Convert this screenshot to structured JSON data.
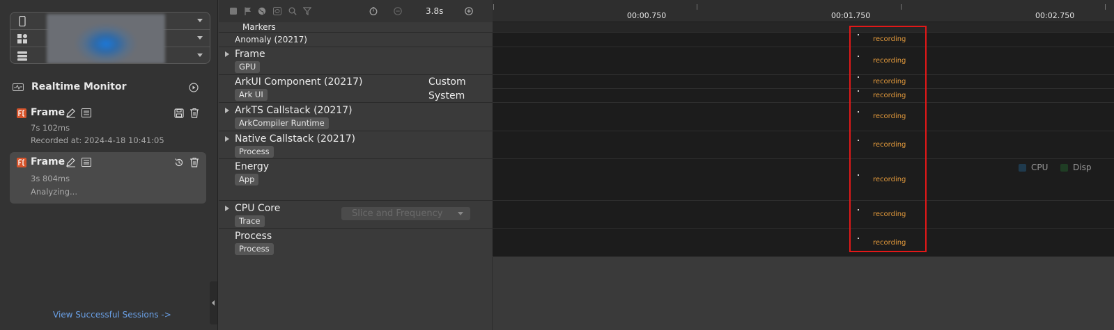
{
  "sidebar": {
    "realtime_monitor": "Realtime Monitor",
    "sessions": [
      {
        "title": "Frame",
        "duration": "7s 102ms",
        "status": "Recorded at: 2024-4-18 10:41:05"
      },
      {
        "title": "Frame",
        "duration": "3s 804ms",
        "status": "Analyzing..."
      }
    ],
    "view_link": "View Successful Sessions ->"
  },
  "toolbar": {
    "zoom_value": "3.8s",
    "icons": [
      "stop-icon",
      "flag-icon",
      "globe-icon",
      "refresh-icon",
      "search-icon",
      "filter-icon",
      "timer-icon",
      "zoom-out-icon",
      "zoom-in-icon"
    ]
  },
  "ruler": {
    "ticks": [
      "00:00.750",
      "00:01.750",
      "00:02.750"
    ]
  },
  "lanes": [
    {
      "name": "Markers"
    },
    {
      "name": "Anomaly (20217)"
    },
    {
      "name": "Frame",
      "tag": "GPU"
    },
    {
      "name": "ArkUI Component (20217)",
      "tag": "Ark UI",
      "side_top": "Custom",
      "side_bottom": "System"
    },
    {
      "name": "ArkTS Callstack (20217)",
      "tag": "ArkCompiler Runtime"
    },
    {
      "name": "Native Callstack (20217)",
      "tag": "Process"
    },
    {
      "name": "Energy",
      "tag": "App"
    },
    {
      "name": "CPU Core",
      "tag": "Trace",
      "dropdown": "Slice and Frequency"
    },
    {
      "name": "Process",
      "tag": "Process"
    }
  ],
  "recording_label": "recording",
  "legend": [
    {
      "label": "CPU",
      "color": "#1f3a4d"
    },
    {
      "label": "Disp",
      "color": "#1f3d24"
    }
  ],
  "colors": {
    "accent_link": "#6aa0e6",
    "recording": "#e59b3c",
    "highlight": "#e31818"
  }
}
